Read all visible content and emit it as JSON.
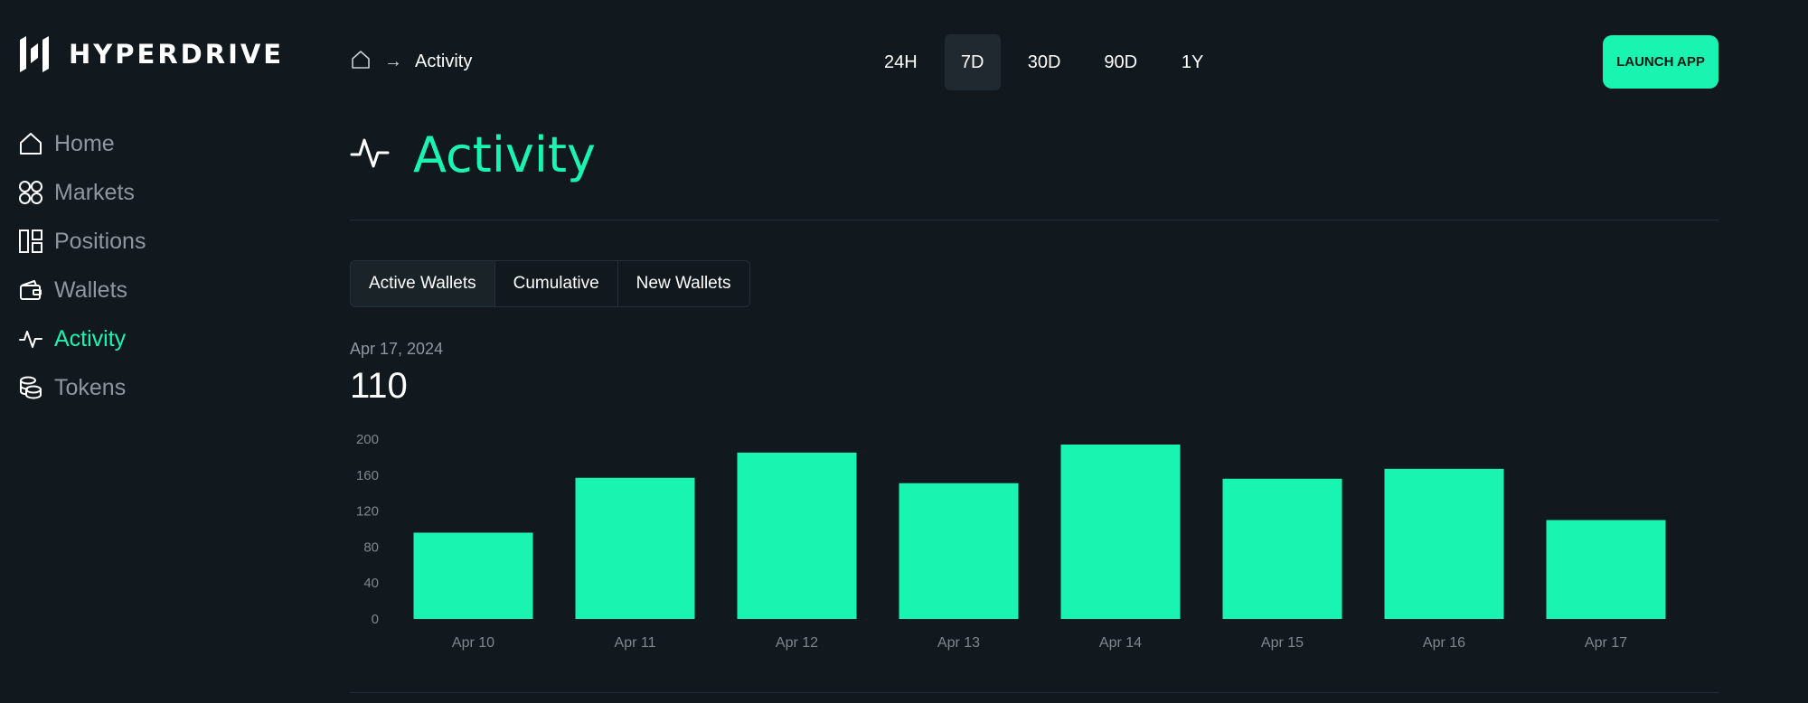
{
  "brand": {
    "name": "HYPERDRIVE",
    "accent": "#19f5b0"
  },
  "sidebar": {
    "items": [
      {
        "label": "Home",
        "icon": "home-icon",
        "active": false
      },
      {
        "label": "Markets",
        "icon": "markets-icon",
        "active": false
      },
      {
        "label": "Positions",
        "icon": "positions-icon",
        "active": false
      },
      {
        "label": "Wallets",
        "icon": "wallet-icon",
        "active": false
      },
      {
        "label": "Activity",
        "icon": "activity-icon",
        "active": true
      },
      {
        "label": "Tokens",
        "icon": "tokens-icon",
        "active": false
      }
    ]
  },
  "header": {
    "breadcrumb_current": "Activity",
    "ranges": [
      "24H",
      "7D",
      "30D",
      "90D",
      "1Y"
    ],
    "selected_range": "7D",
    "launch_label": "LAUNCH APP"
  },
  "page": {
    "title": "Activity",
    "tabs": [
      "Active Wallets",
      "Cumulative",
      "New Wallets"
    ],
    "selected_tab": "Active Wallets",
    "date": "Apr 17, 2024",
    "value": "110"
  },
  "chart_data": {
    "type": "bar",
    "categories": [
      "Apr 10",
      "Apr 11",
      "Apr 12",
      "Apr 13",
      "Apr 14",
      "Apr 15",
      "Apr 16",
      "Apr 17"
    ],
    "values": [
      96,
      157,
      185,
      151,
      194,
      156,
      167,
      110
    ],
    "ylim": [
      0,
      200
    ],
    "yticks": [
      0,
      40,
      80,
      120,
      160,
      200
    ],
    "grid": false,
    "bar_color": "#19f5b0"
  }
}
